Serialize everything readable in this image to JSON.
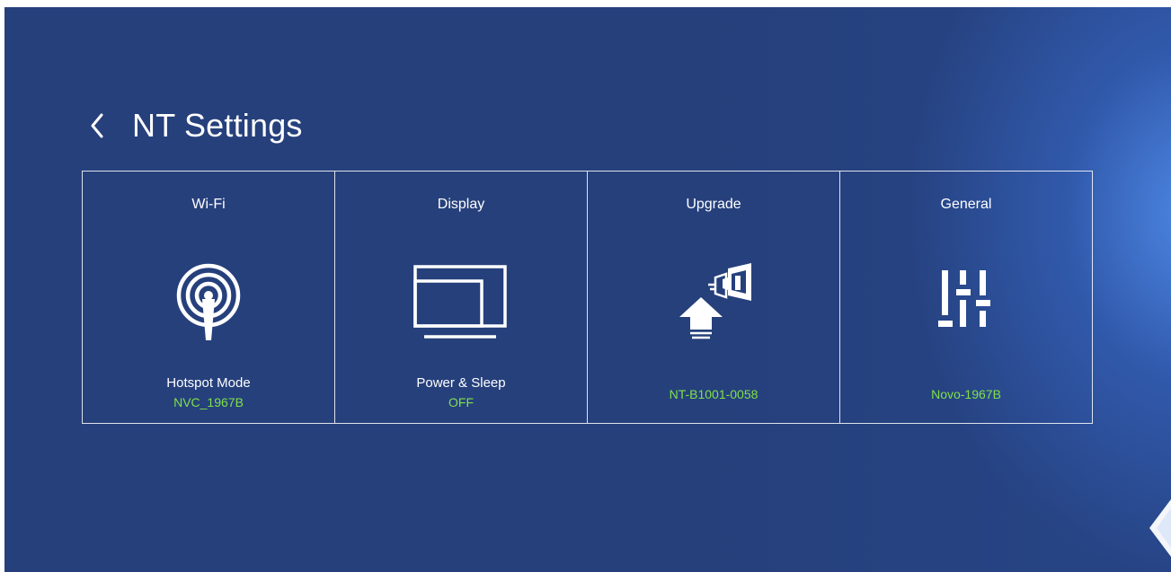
{
  "header": {
    "title": "NT Settings",
    "back_icon": "chevron-left-icon"
  },
  "tiles": [
    {
      "title": "Wi-Fi",
      "icon": "wifi-hotspot-icon",
      "label": "Hotspot Mode",
      "value": "NVC_1967B"
    },
    {
      "title": "Display",
      "icon": "display-monitor-icon",
      "label": "Power & Sleep",
      "value": "OFF"
    },
    {
      "title": "Upgrade",
      "icon": "upgrade-arrow-icon",
      "value": "NT-B1001-0058"
    },
    {
      "title": "General",
      "icon": "sliders-icon",
      "value": "Novo-1967B"
    }
  ],
  "colors": {
    "background": "#26407c",
    "accent_value": "#7fe04a",
    "text": "#ffffff"
  },
  "side_control": {
    "icon": "chevron-left-icon"
  }
}
